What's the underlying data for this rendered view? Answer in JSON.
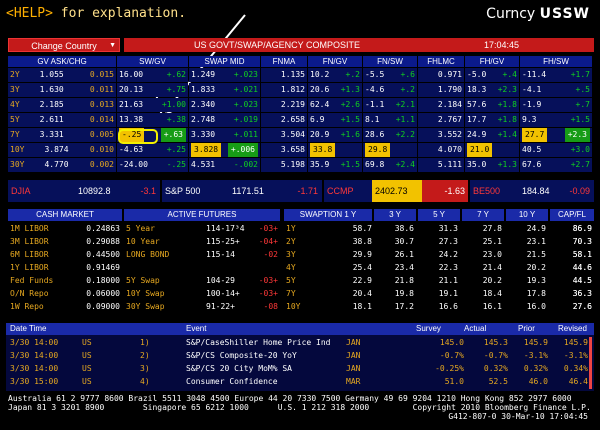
{
  "header": {
    "help_key": "<HELP>",
    "help_text": " for explanation.",
    "currency": "Curncy",
    "ticker": "USSW"
  },
  "bar": {
    "change_country": "Change Country",
    "title": "US GOVT/SWAP/AGENCY COMPOSITE",
    "time": "17:04:45"
  },
  "grid": {
    "headers": [
      "GV ASK/CHG",
      "SW/GV",
      "SWAP MID",
      "FNMA",
      "FN/GV",
      "FN/SW",
      "FHLMC",
      "FH/GV",
      "FH/SW"
    ],
    "rows": [
      {
        "t": "2Y",
        "gv": "1.055",
        "gvc": "0.015",
        "sw": "16.00",
        "swc": "+.62",
        "sm": "1.249",
        "smc": "+.023",
        "fn": "1.135",
        "fg": "10.2",
        "fgc": "+.2",
        "fs": "-5.5",
        "fsc": "+.6",
        "fh": "0.971",
        "hg": "-5.0",
        "hgc": "+.4",
        "hs": "-11.4",
        "hsc": "+1.7"
      },
      {
        "t": "3Y",
        "gv": "1.630",
        "gvc": "0.011",
        "sw": "20.13",
        "swc": "+.75",
        "sm": "1.833",
        "smc": "+.021",
        "fn": "1.812",
        "fg": "20.6",
        "fgc": "+1.3",
        "fs": "-4.6",
        "fsc": "+.2",
        "fh": "1.790",
        "hg": "18.3",
        "hgc": "+2.3",
        "hs": "-4.1",
        "hsc": "+.5"
      },
      {
        "t": "4Y",
        "gv": "2.185",
        "gvc": "0.013",
        "sw": "21.63",
        "swc": "+1.00",
        "sm": "2.340",
        "smc": "+.023",
        "fn": "2.219",
        "fg": "62.4",
        "fgc": "+2.6",
        "fs": "-1.1",
        "fsc": "+2.1",
        "fh": "2.184",
        "hg": "57.6",
        "hgc": "+1.8",
        "hs": "-1.9",
        "hsc": "+.7"
      },
      {
        "t": "5Y",
        "gv": "2.611",
        "gvc": "0.014",
        "sw": "13.38",
        "swc": "+.38",
        "sm": "2.748",
        "smc": "+.019",
        "fn": "2.658",
        "fg": "6.9",
        "fgc": "+1.5",
        "fs": "8.1",
        "fsc": "+1.1",
        "fh": "2.767",
        "hg": "17.7",
        "hgc": "+1.8",
        "hs": "9.3",
        "hsc": "+1.5"
      },
      {
        "t": "7Y",
        "gv": "3.331",
        "gvc": "0.005",
        "sw": "-.25",
        "swc": "+.63",
        "sm": "3.330",
        "smc": "+.011",
        "fn": "3.504",
        "fg": "20.9",
        "fgc": "+1.6",
        "fs": "28.6",
        "fsc": "+2.2",
        "fh": "3.552",
        "hg": "24.9",
        "hgc": "+1.4",
        "hs": "27.7",
        "hsc": "+2.3"
      },
      {
        "t": "10Y",
        "gv": "3.874",
        "gvc": "0.010",
        "sw": "-4.63",
        "swc": "+.25",
        "sm": "3.828",
        "smc": "+.006",
        "fn": "3.658",
        "fg": "33.8",
        "fgc": "+1.6",
        "fs": "29.8",
        "fsc": "+3.9",
        "fh": "4.070",
        "hg": "21.0",
        "hgc": "+1.1",
        "hs": "40.5",
        "hsc": "+3.0"
      },
      {
        "t": "30Y",
        "gv": "4.770",
        "gvc": "0.002",
        "sw": "-24.00",
        "swc": "-.25",
        "sm": "4.531",
        "smc": "-.002",
        "fn": "5.198",
        "fg": "35.9",
        "fgc": "+1.5",
        "fs": "69.8",
        "fsc": "+2.4",
        "fh": "5.111",
        "hg": "35.0",
        "hgc": "+1.3",
        "hs": "67.6",
        "hsc": "+2.7"
      }
    ]
  },
  "strip": {
    "djia": "DJIA",
    "djia_v": "10892.8",
    "djia_c": "-3.1",
    "sp": "S&P 500",
    "sp_v": "1171.51",
    "sp_c": "-1.71",
    "ccmp": "CCMP",
    "ccmp_v": "2402.73",
    "ccmp_c": "-1.63",
    "be": "BE500",
    "be_v": "184.84",
    "be_c": "-0.09"
  },
  "cash": {
    "title": "CASH MARKET",
    "rows": [
      {
        "n": "1M LIBOR",
        "v": "0.24863"
      },
      {
        "n": "3M LIBOR",
        "v": "0.29088"
      },
      {
        "n": "6M LIBOR",
        "v": "0.44500"
      },
      {
        "n": "1Y LIBOR",
        "v": "0.91469"
      },
      {
        "n": "Fed Funds",
        "v": "0.18000"
      },
      {
        "n": "O/N Repo",
        "v": "0.06000"
      },
      {
        "n": "1W Repo",
        "v": "0.09000"
      }
    ]
  },
  "futures": {
    "title": "ACTIVE FUTURES",
    "rows": [
      {
        "n": "5 Year",
        "v": "114-17³4",
        "c": "-03+"
      },
      {
        "n": "10 Year",
        "v": "115-25+",
        "c": "-04+"
      },
      {
        "n": "LONG BOND",
        "v": "115-14",
        "c": "-02"
      },
      {
        "n": "",
        "v": "",
        "c": ""
      },
      {
        "n": "5Y Swap",
        "v": "104-29",
        "c": "-03+"
      },
      {
        "n": "10Y Swap",
        "v": "100-14+",
        "c": "-03+"
      },
      {
        "n": "30Y Swap",
        "v": "91-22+",
        "c": "-08"
      }
    ]
  },
  "swaption": {
    "headers": [
      "SWAPTION 1 Y",
      "3 Y",
      "5 Y",
      "7 Y",
      "10 Y",
      "CAP/FL"
    ],
    "rows": [
      [
        "1Y",
        "58.7",
        "38.6",
        "31.3",
        "27.8",
        "24.9",
        "86.9"
      ],
      [
        "2Y",
        "38.8",
        "30.7",
        "27.3",
        "25.1",
        "23.1",
        "70.3"
      ],
      [
        "3Y",
        "29.9",
        "26.1",
        "24.2",
        "23.0",
        "21.5",
        "58.1"
      ],
      [
        "4Y",
        "25.4",
        "23.4",
        "22.3",
        "21.4",
        "20.2",
        "44.6"
      ],
      [
        "5Y",
        "22.9",
        "21.8",
        "21.1",
        "20.2",
        "19.3",
        "44.5"
      ],
      [
        "7Y",
        "20.4",
        "19.8",
        "19.1",
        "18.4",
        "17.8",
        "36.3"
      ],
      [
        "10Y",
        "18.1",
        "17.2",
        "16.6",
        "16.1",
        "16.0",
        "27.6"
      ]
    ]
  },
  "events": {
    "headers": {
      "date": "Date Time",
      "event": "Event",
      "survey": "Survey",
      "actual": "Actual",
      "prior": "Prior",
      "revised": "Revised"
    },
    "rows": [
      {
        "d": "3/30 14:00",
        "c": "US",
        "n": "1)",
        "e": "S&P/CaseShiller Home Price Ind",
        "p": "JAN",
        "s": "145.0",
        "a": "145.3",
        "pr": "145.9",
        "rv": "145.9"
      },
      {
        "d": "3/30 14:00",
        "c": "US",
        "n": "2)",
        "e": "S&P/CS Composite-20 YoY",
        "p": "JAN",
        "s": "-0.7%",
        "a": "-0.7%",
        "pr": "-3.1%",
        "rv": "-3.1%"
      },
      {
        "d": "3/30 14:00",
        "c": "US",
        "n": "3)",
        "e": "S&P/CS 20 City MoM% SA",
        "p": "JAN",
        "s": "-0.25%",
        "a": "0.32%",
        "pr": "0.32%",
        "rv": "0.34%"
      },
      {
        "d": "3/30 15:00",
        "c": "US",
        "n": "4)",
        "e": "Consumer Confidence",
        "p": "MAR",
        "s": "51.0",
        "a": "52.5",
        "pr": "46.0",
        "rv": "46.4"
      }
    ]
  },
  "footer": {
    "l1": "Australia 61 2 9777 8600 Brazil 5511 3048 4500 Europe 44 20 7330 7500 Germany 49 69 9204 1210 Hong Kong 852 2977 6000",
    "l2": "Japan 81 3 3201 8900        Singapore 65 6212 1000      U.S. 1 212 318 2000         Copyright 2010 Bloomberg Finance L.P.",
    "l3": "G412-807-0 30-Mar-10 17:04:45"
  }
}
